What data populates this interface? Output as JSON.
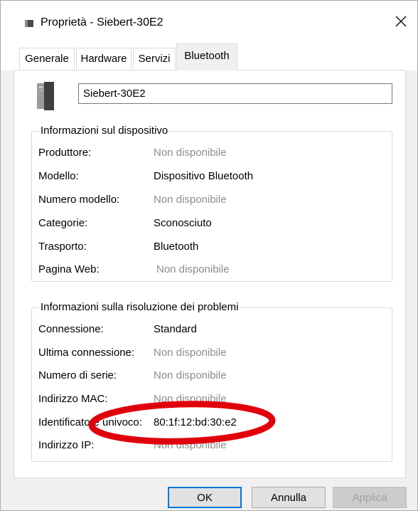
{
  "window": {
    "title": "Proprietà - Siebert-30E2"
  },
  "tabs": [
    {
      "label": "Generale",
      "active": false
    },
    {
      "label": "Hardware",
      "active": false
    },
    {
      "label": "Servizi",
      "active": false
    },
    {
      "label": "Bluetooth",
      "active": true
    }
  ],
  "device": {
    "name": "Siebert-30E2"
  },
  "device_info": {
    "title": "Informazioni sul dispositivo",
    "rows": [
      {
        "label": "Produttore:",
        "value": "Non disponibile",
        "muted": true
      },
      {
        "label": "Modello:",
        "value": "Dispositivo Bluetooth",
        "muted": false
      },
      {
        "label": "Numero modello:",
        "value": "Non disponibile",
        "muted": true
      },
      {
        "label": "Categorie:",
        "value": "Sconosciuto",
        "muted": false
      },
      {
        "label": "Trasporto:",
        "value": "Bluetooth",
        "muted": false
      },
      {
        "label": "Pagina Web:",
        "value": "Non disponibile",
        "muted": true
      }
    ]
  },
  "troubleshooting": {
    "title": "Informazioni sulla risoluzione dei problemi",
    "rows": [
      {
        "label": "Connessione:",
        "value": "Standard",
        "muted": false
      },
      {
        "label": "Ultima connessione:",
        "value": "Non disponibile",
        "muted": true
      },
      {
        "label": "Numero di serie:",
        "value": "Non disponibile",
        "muted": true
      },
      {
        "label": "Indirizzo MAC:",
        "value": "Non disponibile",
        "muted": true
      },
      {
        "label": "Identificatore univoco:",
        "value": "80:1f:12:bd:30:e2",
        "muted": false
      },
      {
        "label": "Indirizzo IP:",
        "value": "Non disponibile",
        "muted": true
      }
    ]
  },
  "buttons": {
    "ok": "OK",
    "cancel": "Annulla",
    "apply": "Applica"
  },
  "colors": {
    "annotation_ellipse": "#e0000b",
    "muted_text": "#8c8c8c",
    "primary_border": "#0078d7"
  }
}
